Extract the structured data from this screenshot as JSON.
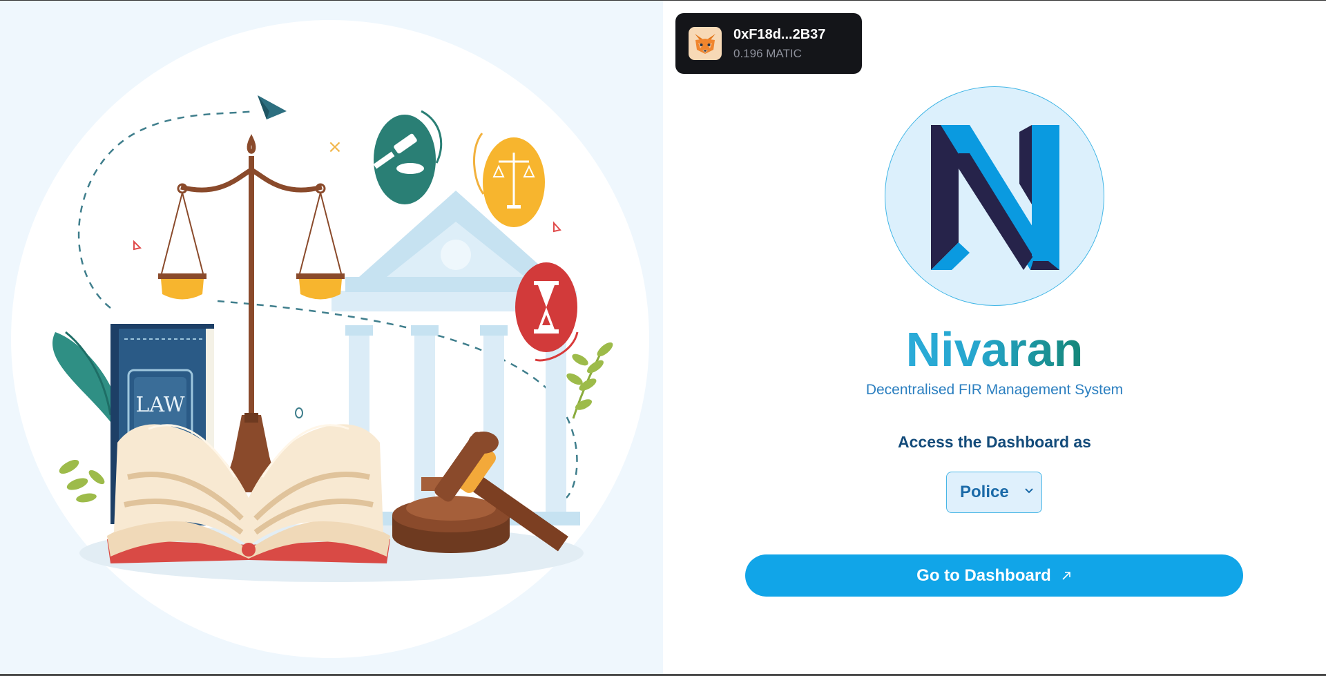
{
  "wallet": {
    "address": "0xF18d...2B37",
    "balance": "0.196 MATIC",
    "icon": "metamask-fox-icon"
  },
  "illustration": {
    "book_label": "LAW"
  },
  "brand": {
    "logo_letter": "N",
    "name": "Nivaran",
    "tagline": "Decentralised FIR Management System"
  },
  "access": {
    "label": "Access the Dashboard as",
    "selected_role": "Police"
  },
  "cta": {
    "label": "Go to Dashboard",
    "icon": "arrow-up-right-icon"
  },
  "colors": {
    "accent": "#11a5e8",
    "wallet_bg": "#141519",
    "title_start": "#2fb1e5",
    "title_end": "#0e7d6b",
    "tagline": "#2b7fc0",
    "logo_dark": "#26234a",
    "logo_light": "#0a9ae0"
  }
}
